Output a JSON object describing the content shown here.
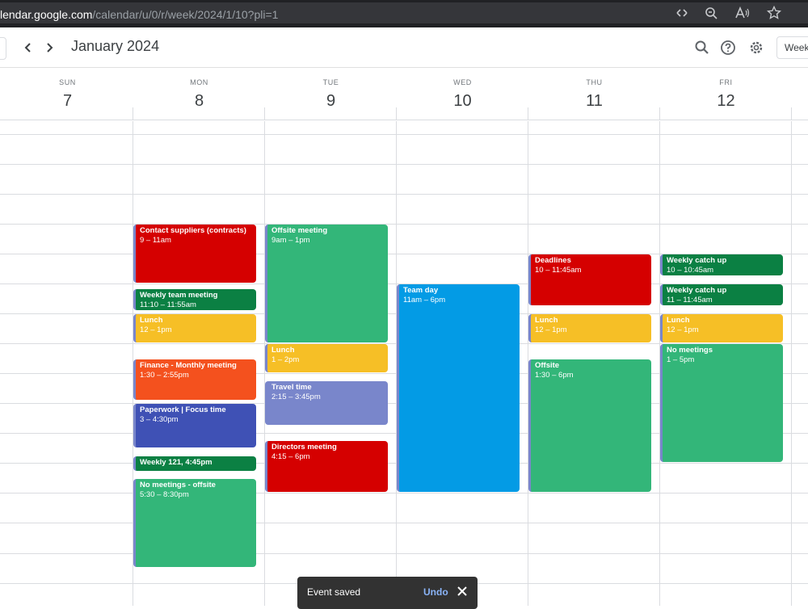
{
  "browser": {
    "url_host": "lendar.google.com",
    "url_path": "/calendar/u/0/r/week/2024/1/10?pli=1",
    "icons": [
      "reader-icon",
      "zoom-icon",
      "read-aloud-icon",
      "favorite-star-icon"
    ]
  },
  "header": {
    "month_title": "January 2024",
    "prev_label": "‹",
    "next_label": "›",
    "view_label": "Week"
  },
  "days": [
    {
      "name": "SUN",
      "num": "7"
    },
    {
      "name": "MON",
      "num": "8"
    },
    {
      "name": "TUE",
      "num": "9"
    },
    {
      "name": "WED",
      "num": "10"
    },
    {
      "name": "THU",
      "num": "11"
    },
    {
      "name": "FRI",
      "num": "12"
    }
  ],
  "events": [
    {
      "day": 1,
      "title": "Contact suppliers (contracts)",
      "time": "9 – 11am",
      "color": "#d50000"
    },
    {
      "day": 1,
      "title": "Weekly team meeting",
      "time": "11:10 – 11:55am",
      "color": "#0b8043"
    },
    {
      "day": 1,
      "title": "Lunch",
      "time": "12 – 1pm",
      "color": "#f6bf26"
    },
    {
      "day": 1,
      "title": "Finance - Monthly meeting",
      "time": "1:30 – 2:55pm",
      "color": "#f4511e"
    },
    {
      "day": 1,
      "title": "Paperwork | Focus time",
      "time": "3 – 4:30pm",
      "color": "#3f51b5"
    },
    {
      "day": 1,
      "title": "Weekly 121, 4:45pm",
      "time": "",
      "color": "#0b8043"
    },
    {
      "day": 1,
      "title": "No meetings - offsite",
      "time": "5:30 – 8:30pm",
      "color": "#33b679"
    },
    {
      "day": 2,
      "title": "Offsite meeting",
      "time": "9am – 1pm",
      "color": "#33b679"
    },
    {
      "day": 2,
      "title": "Lunch",
      "time": "1 – 2pm",
      "color": "#f6bf26"
    },
    {
      "day": 2,
      "title": "Travel time",
      "time": "2:15 – 3:45pm",
      "color": "#7986cb"
    },
    {
      "day": 2,
      "title": "Directors meeting",
      "time": "4:15 – 6pm",
      "color": "#d50000"
    },
    {
      "day": 3,
      "title": "Team day",
      "time": "11am – 6pm",
      "color": "#039be5"
    },
    {
      "day": 4,
      "title": "Deadlines",
      "time": "10 – 11:45am",
      "color": "#d50000"
    },
    {
      "day": 4,
      "title": "Lunch",
      "time": "12 – 1pm",
      "color": "#f6bf26"
    },
    {
      "day": 4,
      "title": "Offsite",
      "time": "1:30 – 6pm",
      "color": "#33b679"
    },
    {
      "day": 5,
      "title": "Weekly catch up",
      "time": "10 – 10:45am",
      "color": "#0b8043"
    },
    {
      "day": 5,
      "title": "Weekly catch up",
      "time": "11 – 11:45am",
      "color": "#0b8043"
    },
    {
      "day": 5,
      "title": "Lunch",
      "time": "12 – 1pm",
      "color": "#f6bf26"
    },
    {
      "day": 5,
      "title": "No meetings",
      "time": "1 – 5pm",
      "color": "#33b679"
    }
  ],
  "snackbar": {
    "text": "Event saved",
    "undo_label": "Undo"
  }
}
